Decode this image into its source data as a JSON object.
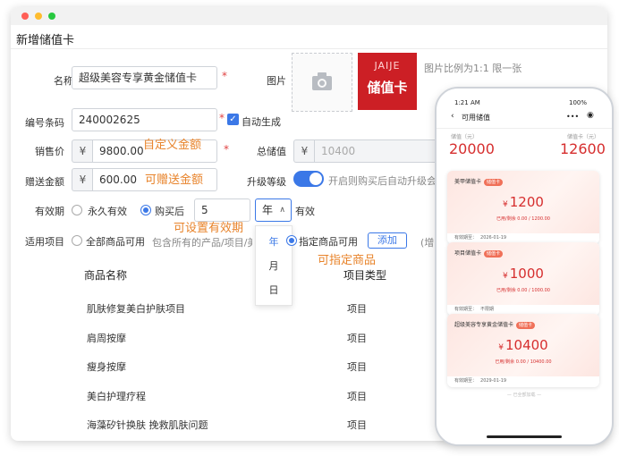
{
  "dialog": {
    "title": "新增储值卡"
  },
  "form": {
    "name_label": "名称",
    "name_value": "超级美容专享黄金储值卡",
    "image_label": "图片",
    "image_hint": "图片比例为1:1 限一张",
    "card_thumb_line1": "JAIJE",
    "card_thumb_line2": "储值卡",
    "code_label": "编号条码",
    "code_value": "240002625",
    "auto_generate_label": "自动生成",
    "price_label": "销售价",
    "currency": "¥",
    "price_value": "9800.00",
    "price_note": "自定义金额",
    "total_value_label": "总储值",
    "total_value": "10400",
    "gift_label": "赠送金额",
    "gift_value": "600.00",
    "gift_note": "可赠送金额",
    "upgrade_label": "升级等级",
    "upgrade_hint": "开启则购买后自动升级会",
    "validity_label": "有效期",
    "validity_forever": "永久有效",
    "validity_after": "购买后",
    "validity_number": "5",
    "validity_unit": "年",
    "validity_suffix": "有效",
    "validity_note": "可设置有效期",
    "unit_options": [
      "年",
      "月",
      "日"
    ],
    "scope_label": "适用项目",
    "scope_all": "全部商品可用",
    "scope_all_hint": "包含所有的产品/项目/美",
    "scope_specified": "指定商品可用",
    "add_button": "添加",
    "scope_hint_tail": "(增",
    "scope_note": "可指定商品"
  },
  "table": {
    "headers": [
      "商品名称",
      "项目类型"
    ],
    "rows": [
      [
        "肌肤修复美白护肤项目",
        "项目"
      ],
      [
        "肩周按摩",
        "项目"
      ],
      [
        "瘦身按摩",
        "项目"
      ],
      [
        "美白护理疗程",
        "项目"
      ],
      [
        "海藻矽针换肤 挽救肌肤问题",
        "项目"
      ]
    ]
  },
  "phone": {
    "time": "1:21 AM",
    "battery": "100%",
    "title": "可用储值",
    "left_label": "储值（元）",
    "left_value": "20000",
    "right_label": "储值卡（元）",
    "right_value": "12600",
    "cards": [
      {
        "name": "美甲储值卡",
        "tag": "储值卡",
        "amount": "1200",
        "used": "已用/剩余 0.00 / 1200.00",
        "expire_label": "有效期至：",
        "expire": "2026-01-19"
      },
      {
        "name": "项目储值卡",
        "tag": "储值卡",
        "amount": "1000",
        "used": "已用/剩余 0.00 / 1000.00",
        "expire_label": "有效期至：",
        "expire": "不限期"
      },
      {
        "name": "超级美容专享黄金储值卡",
        "tag": "储值卡",
        "amount": "10400",
        "used": "已用/剩余 0.00 / 10400.00",
        "expire_label": "有效期至：",
        "expire": "2029-01-19"
      }
    ],
    "currency": "¥",
    "footer": "— 已全部加载 —"
  },
  "colors": {
    "accent": "#3b78e7",
    "note": "#e8832a",
    "price": "#d62e2e",
    "card_red": "#cc1f25"
  }
}
